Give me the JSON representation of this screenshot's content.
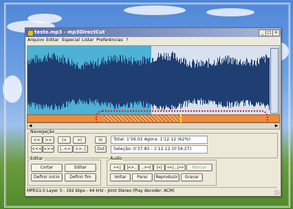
{
  "window": {
    "title": "teste.mp3 - mp3DirectCut",
    "controls": [
      "_",
      "□",
      "×"
    ]
  },
  "menu": [
    "Arquivo",
    "Editar",
    "Especial",
    "Listar",
    "Preferências",
    "?"
  ],
  "navigation": {
    "label": "Navegação",
    "row1": [
      "<<",
      ">>",
      "|<",
      ">|",
      "In"
    ],
    "row2": [
      "<<<",
      ">>>",
      "|..<<",
      ">>..|",
      "Out"
    ],
    "total_text": "Total: 1'56.01  Agora: 1'12.12  (62%)",
    "selection_text": "Seleção: 0'37.85 - 1'12.12 (0'34.27)"
  },
  "edit": {
    "label": "Editar",
    "buttons": [
      "Cortar",
      "Editar",
      "Definir início",
      "Definir fim"
    ]
  },
  "audio": {
    "label": "Áudio",
    "row1": [
      "«<|",
      "|»>..",
      "..>»|",
      "|»|",
      "«»|...|»»",
      "Marcar"
    ],
    "row2": [
      "Voltar",
      "Parar",
      "Reproduzir",
      "Gravar"
    ]
  },
  "status": "MPEG1.0 Layer 3 - 192 kbps - 44 kHz - Joint Stereo  (Play decoder: ACM)",
  "colors": {
    "waveform": "#1f3f73",
    "selection": "#4db2d6",
    "position_bar": "#f08a3a",
    "highlight_ring": "#d81e1e"
  }
}
